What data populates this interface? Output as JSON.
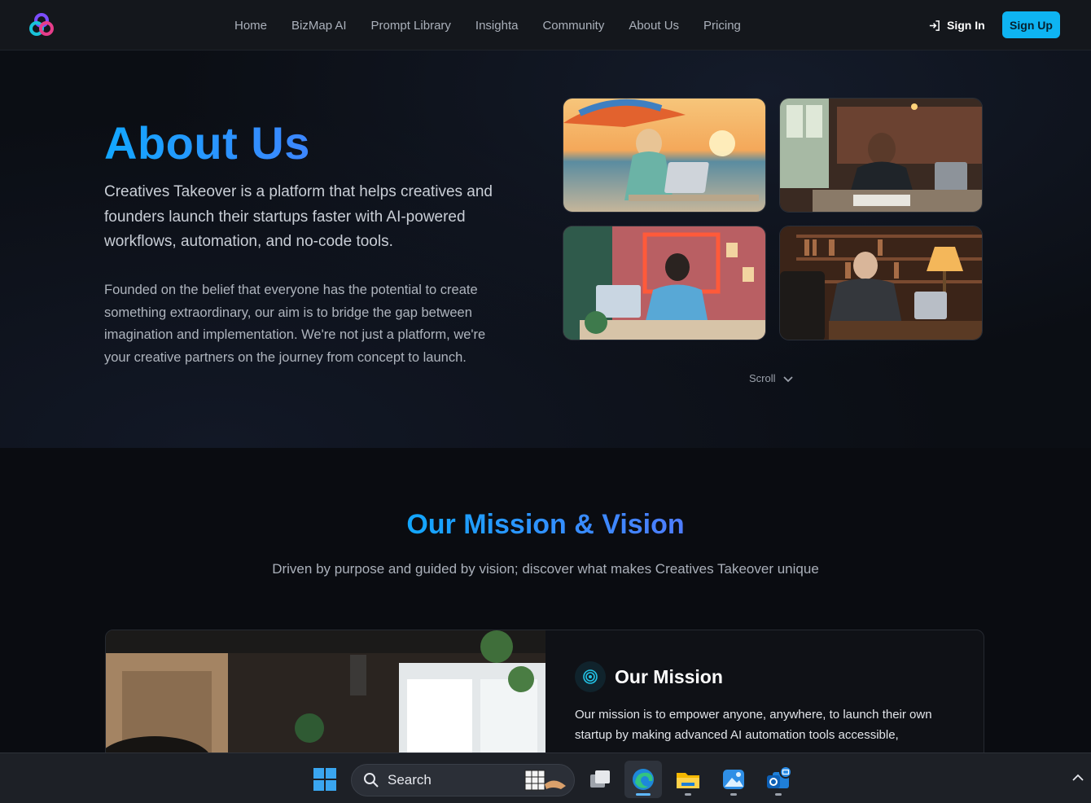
{
  "nav": {
    "links": [
      "Home",
      "BizMap AI",
      "Prompt Library",
      "Insighta",
      "Community",
      "About Us",
      "Pricing"
    ],
    "signin_label": "Sign In",
    "signup_label": "Sign Up"
  },
  "hero": {
    "title": "About Us",
    "lead": "Creatives Takeover is a platform that helps creatives and founders launch their startups faster with AI-powered workflows, automation, and no-code tools.",
    "body": "Founded on the belief that everyone has the potential to create something extraordinary, our aim is to bridge the gap between imagination and implementation. We're not just a platform, we're your creative partners on the journey from concept to launch.",
    "scroll_label": "Scroll"
  },
  "mission_section": {
    "title": "Our Mission & Vision",
    "subtitle": "Driven by purpose and guided by vision; discover what makes Creatives Takeover unique",
    "card": {
      "title": "Our Mission",
      "text": "Our mission is to empower anyone, anywhere, to launch their own startup by making advanced AI automation tools accessible,"
    }
  },
  "taskbar": {
    "search_label": "Search"
  },
  "colors": {
    "accent": "#0eb4f2",
    "title_gradient_start": "#12a7ff",
    "title_gradient_end": "#3d86ff",
    "background": "#0a0c11"
  }
}
